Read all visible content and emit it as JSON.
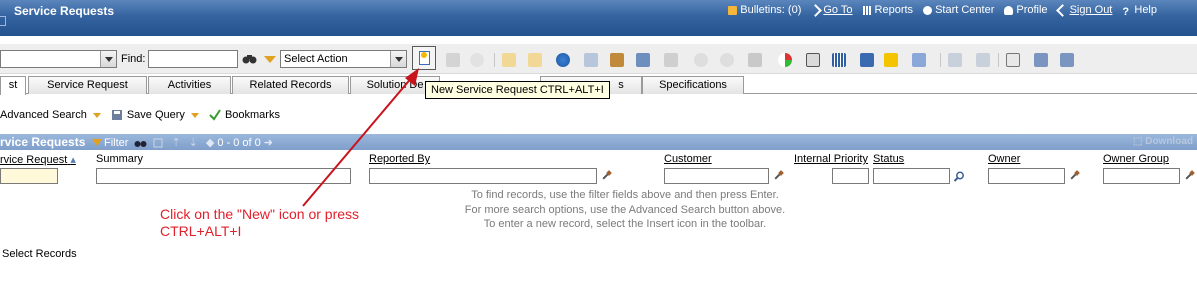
{
  "titlebar": {
    "app_title": "Service Requests",
    "nav": {
      "bulletins": "Bulletins: (0)",
      "goto": "Go To",
      "reports": "Reports",
      "start_center": "Start Center",
      "profile": "Profile",
      "sign_out": "Sign Out",
      "help": "Help"
    }
  },
  "toolbar": {
    "find_label": "Find:",
    "find_value": "",
    "action_select_value": "Select Action",
    "tooltip": "New Service Request   CTRL+ALT+I"
  },
  "tabs": {
    "items": [
      "st",
      "Service Request",
      "Activities",
      "Related Records",
      "Solution De",
      "s",
      "Specifications"
    ],
    "active": "st"
  },
  "subbar": {
    "advanced_search": "Advanced Search",
    "save_query": "Save Query",
    "bookmarks": "Bookmarks"
  },
  "results": {
    "title": "rvice Requests",
    "filter": "Filter",
    "paging": "0 - 0 of 0",
    "download": "Download",
    "columns": {
      "service_request": "rvice Request",
      "summary": "Summary",
      "reported_by": "Reported By",
      "customer": "Customer",
      "internal_priority": "Internal Priority",
      "status": "Status",
      "owner": "Owner",
      "owner_group": "Owner Group"
    },
    "hints": [
      "To find records, use the filter fields above and then press Enter.",
      "For more search options, use the Advanced Search button above.",
      "To enter a new record, select the Insert icon in the toolbar."
    ],
    "select_records": "Select Records"
  },
  "annotation": {
    "line1": "Click on the \"New\" icon or press",
    "line2": "CTRL+ALT+I",
    "color": "#e21f2b"
  },
  "colors": {
    "titlebar": "#34639f",
    "results_bar": "#8eabd3",
    "toolbar_bg": "#eeeeee"
  }
}
